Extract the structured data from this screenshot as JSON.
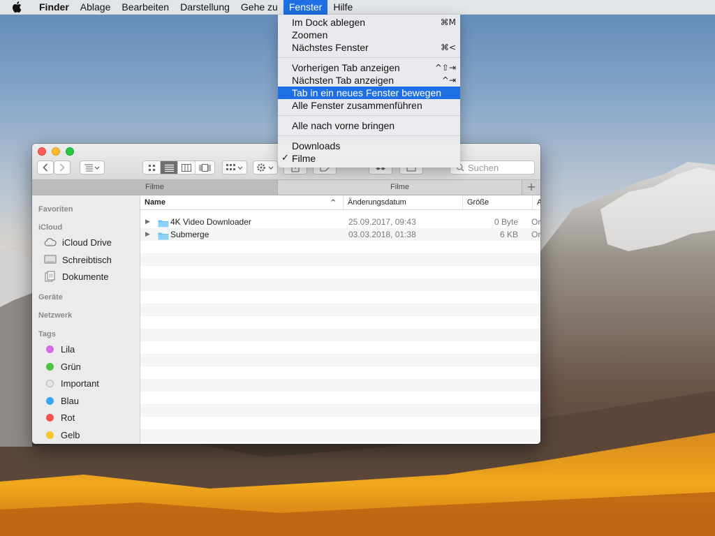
{
  "menubar": {
    "apple_icon": "apple-icon",
    "items": [
      "Finder",
      "Ablage",
      "Bearbeiten",
      "Darstellung",
      "Gehe zu",
      "Fenster",
      "Hilfe"
    ],
    "active": "Fenster",
    "accent": "#1d6fe3"
  },
  "window_menu": {
    "items": [
      {
        "label": "Im Dock ablegen",
        "shortcut": "⌘M"
      },
      {
        "label": "Zoomen",
        "shortcut": ""
      },
      {
        "label": "Nächstes Fenster",
        "shortcut": "⌘<"
      },
      {
        "label": "Vorherigen Tab anzeigen",
        "shortcut": "^⇧⇥"
      },
      {
        "label": "Nächsten Tab anzeigen",
        "shortcut": "^⇥"
      },
      {
        "label": "Tab in ein neues Fenster bewegen",
        "shortcut": "",
        "highlighted": true
      },
      {
        "label": "Alle Fenster zusammenführen",
        "shortcut": ""
      },
      {
        "label": "Alle nach vorne bringen",
        "shortcut": ""
      },
      {
        "label": "Downloads",
        "shortcut": ""
      },
      {
        "label": "Filme",
        "shortcut": "",
        "checked": true
      }
    ],
    "check_mark": "✓"
  },
  "finder": {
    "toolbar": {
      "back_icon": "chevron-left-icon",
      "forward_icon": "chevron-right-icon",
      "view_modes": [
        "icon-view-icon",
        "list-view-icon",
        "column-view-icon",
        "gallery-view-icon"
      ],
      "active_view": "list-view-icon",
      "search_placeholder": "Suchen"
    },
    "tabs": [
      {
        "label": "Filme",
        "active": true
      },
      {
        "label": "Filme",
        "active": false
      }
    ],
    "new_tab_label": "+",
    "sidebar": {
      "favorites_header": "Favoriten",
      "icloud_header": "iCloud",
      "icloud_items": [
        {
          "label": "iCloud Drive",
          "icon": "cloud-icon"
        },
        {
          "label": "Schreibtisch",
          "icon": "desktop-icon"
        },
        {
          "label": "Dokumente",
          "icon": "document-icon"
        }
      ],
      "devices_header": "Geräte",
      "network_header": "Netzwerk",
      "tags_header": "Tags",
      "tags": [
        {
          "label": "Lila",
          "color": "#d56be0"
        },
        {
          "label": "Grün",
          "color": "#4cc443"
        },
        {
          "label": "Important",
          "color": "#e6e6e6"
        },
        {
          "label": "Blau",
          "color": "#36a6f2"
        },
        {
          "label": "Rot",
          "color": "#f0544c"
        },
        {
          "label": "Gelb",
          "color": "#f6c72b"
        }
      ]
    },
    "columns": {
      "name": "Name",
      "sort_indicator": "^",
      "modified": "Änderungsdatum",
      "size": "Größe",
      "kind": "Ar"
    },
    "files": [
      {
        "name": "4K Video Downloader",
        "modified": "25.09.2017, 09:43",
        "size": "0 Byte",
        "kind": "Or"
      },
      {
        "name": "Submerge",
        "modified": "03.03.2018, 01:38",
        "size": "6 KB",
        "kind": "Or"
      }
    ]
  }
}
